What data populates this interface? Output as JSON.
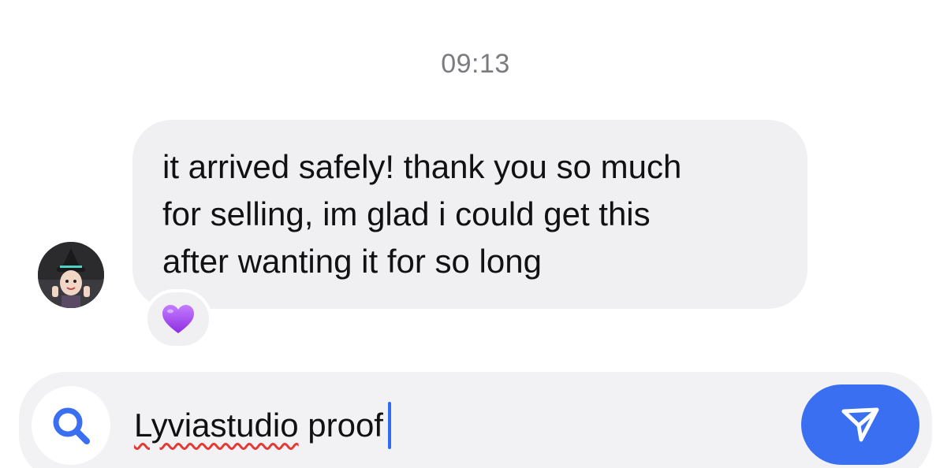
{
  "thread": {
    "timestamp": "09:13"
  },
  "message": {
    "text": "it arrived safely! thank you so much\nfor selling, im glad i could get this\nafter wanting it for so long",
    "reaction_icon": "purple-heart-icon",
    "reaction_color": "#a855f7"
  },
  "composer": {
    "value_word1": "Lyviastudio",
    "value_word2": " proof",
    "search_icon": "search-icon",
    "send_icon": "send-icon",
    "accent_color": "#3a6ff2"
  }
}
